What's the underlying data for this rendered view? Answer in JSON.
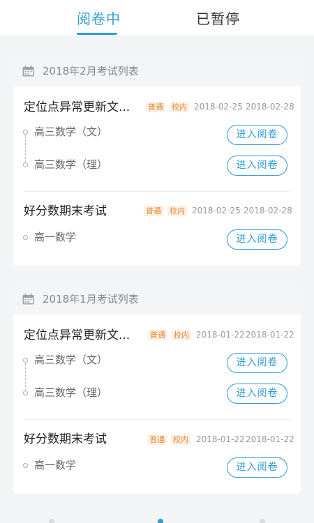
{
  "tabs": {
    "active": "阅卷中",
    "inactive": "已暂停"
  },
  "colors": {
    "accent": "#2e9cda",
    "tag": "#e88a3a"
  },
  "groups": [
    {
      "title": "2018年2月考试列表",
      "exams": [
        {
          "name": "定位点异常更新文...",
          "tags": [
            "普通",
            "校内"
          ],
          "start": "2018-02-25",
          "end": "2018-02-28",
          "subjects": [
            {
              "name": "高三数学（文）",
              "action": "进入阅卷"
            },
            {
              "name": "高三数学（理）",
              "action": "进入阅卷"
            }
          ]
        },
        {
          "name": "好分数期末考试",
          "tags": [
            "普通",
            "校内"
          ],
          "start": "2018-02-25",
          "end": "2018-02-28",
          "subjects": [
            {
              "name": "高一数学",
              "action": "进入阅卷"
            }
          ]
        }
      ]
    },
    {
      "title": "2018年1月考试列表",
      "exams": [
        {
          "name": "定位点异常更新文...",
          "tags": [
            "普通",
            "校内"
          ],
          "start": "2018-01-22",
          "end": "2018-01-22",
          "subjects": [
            {
              "name": "高三数学（文）",
              "action": "进入阅卷"
            },
            {
              "name": "高三数学（理）",
              "action": "进入阅卷"
            }
          ]
        },
        {
          "name": "好分数期末考试",
          "tags": [
            "普通",
            "校内"
          ],
          "start": "2018-01-22",
          "end": "2018-01-22",
          "subjects": [
            {
              "name": "高一数学",
              "action": "进入阅卷"
            }
          ]
        }
      ]
    }
  ]
}
